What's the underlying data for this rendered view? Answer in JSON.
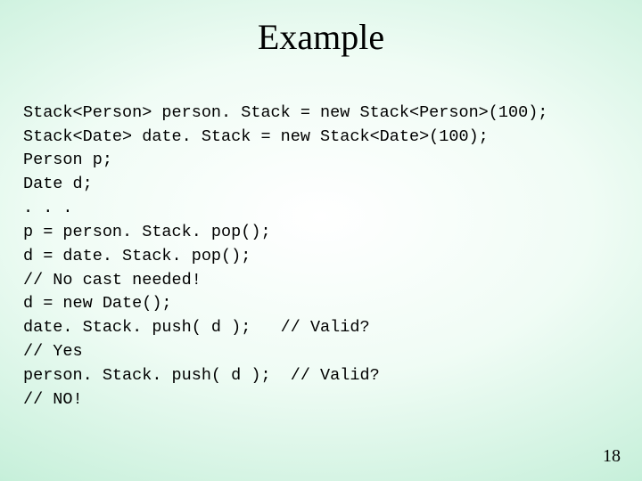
{
  "title": "Example",
  "code_lines": {
    "l0": "Stack<Person> person. Stack = new Stack<Person>(100);",
    "l1": "Stack<Date> date. Stack = new Stack<Date>(100);",
    "l2": "Person p;",
    "l3": "Date d;",
    "l4": ". . .",
    "l5": "p = person. Stack. pop();",
    "l6": "d = date. Stack. pop();",
    "l7": "// No cast needed!",
    "l8": "d = new Date();",
    "l9": "date. Stack. push( d );   // Valid?",
    "l10": "// Yes",
    "l11": "person. Stack. push( d );  // Valid?",
    "l12": "// NO!"
  },
  "page_number": "18"
}
